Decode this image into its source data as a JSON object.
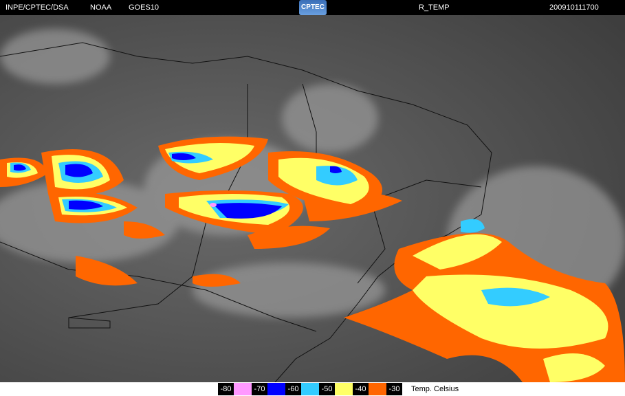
{
  "header": {
    "source": "INPE/CPTEC/DSA",
    "agency": "NOAA",
    "satellite": "GOES10",
    "logo_text": "CPTEC",
    "product": "R_TEMP",
    "datetime": "200910111700"
  },
  "legend": {
    "labels": [
      "-80",
      "-70",
      "-60",
      "-50",
      "-40",
      "-30"
    ],
    "colors": [
      "#ff99ff",
      "#0000ff",
      "#33ccff",
      "#ffff66",
      "#ff6600"
    ],
    "unit_label": "Temp. Celsius"
  }
}
